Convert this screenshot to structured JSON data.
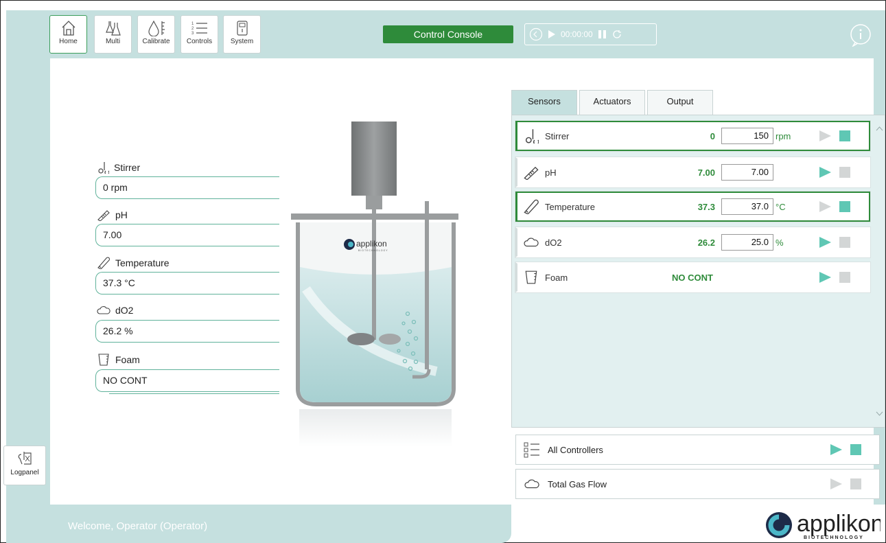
{
  "nav": {
    "home": "Home",
    "multi": "Multi",
    "calibrate": "Calibrate",
    "controls": "Controls",
    "system": "System"
  },
  "console": {
    "label": "Control Console"
  },
  "transport": {
    "time": "00:00:00"
  },
  "logpanel": {
    "label": "Logpanel"
  },
  "welcome": "Welcome, Operator (Operator)",
  "readouts": [
    {
      "name": "Stirrer",
      "value": "0 rpm",
      "icon": "stirrer-icon"
    },
    {
      "name": "pH",
      "value": "7.00",
      "icon": "ph-probe-icon"
    },
    {
      "name": "Temperature",
      "value": "37.3 °C",
      "icon": "thermometer-icon"
    },
    {
      "name": "dO2",
      "value": "26.2 %",
      "icon": "cloud-icon"
    },
    {
      "name": "Foam",
      "value": "NO CONT",
      "icon": "beaker-icon"
    }
  ],
  "vessel": {
    "brand": "applikon",
    "sub": "BIOTECHNOLOGY"
  },
  "tabs": [
    "Sensors",
    "Actuators",
    "Output"
  ],
  "sensors": [
    {
      "name": "Stirrer",
      "actual": "0",
      "setpoint": "150",
      "unit": "rpm",
      "selected": true,
      "play_on": false,
      "stop_on": true
    },
    {
      "name": "pH",
      "actual": "7.00",
      "setpoint": "7.00",
      "unit": "",
      "selected": false,
      "play_on": true,
      "stop_on": false
    },
    {
      "name": "Temperature",
      "actual": "37.3",
      "setpoint": "37.0",
      "unit": "°C",
      "selected": true,
      "play_on": false,
      "stop_on": true
    },
    {
      "name": "dO2",
      "actual": "26.2",
      "setpoint": "25.0",
      "unit": "%",
      "selected": false,
      "play_on": true,
      "stop_on": false
    },
    {
      "name": "Foam",
      "actual": "NO CONT",
      "setpoint": "",
      "unit": "",
      "selected": false,
      "play_on": true,
      "stop_on": false
    }
  ],
  "bottom_rows": [
    {
      "name": "All Controllers",
      "play_on": true,
      "stop_on": true
    },
    {
      "name": "Total Gas Flow",
      "play_on": false,
      "stop_on": false
    }
  ],
  "footer_brand": {
    "name": "applikon",
    "sub": "BIOTECHNOLOGY"
  },
  "colors": {
    "frame": "#c5e0df",
    "accent_green": "#2e8b3a",
    "teal": "#5fc7b4",
    "inactive": "#d3d6d6"
  }
}
